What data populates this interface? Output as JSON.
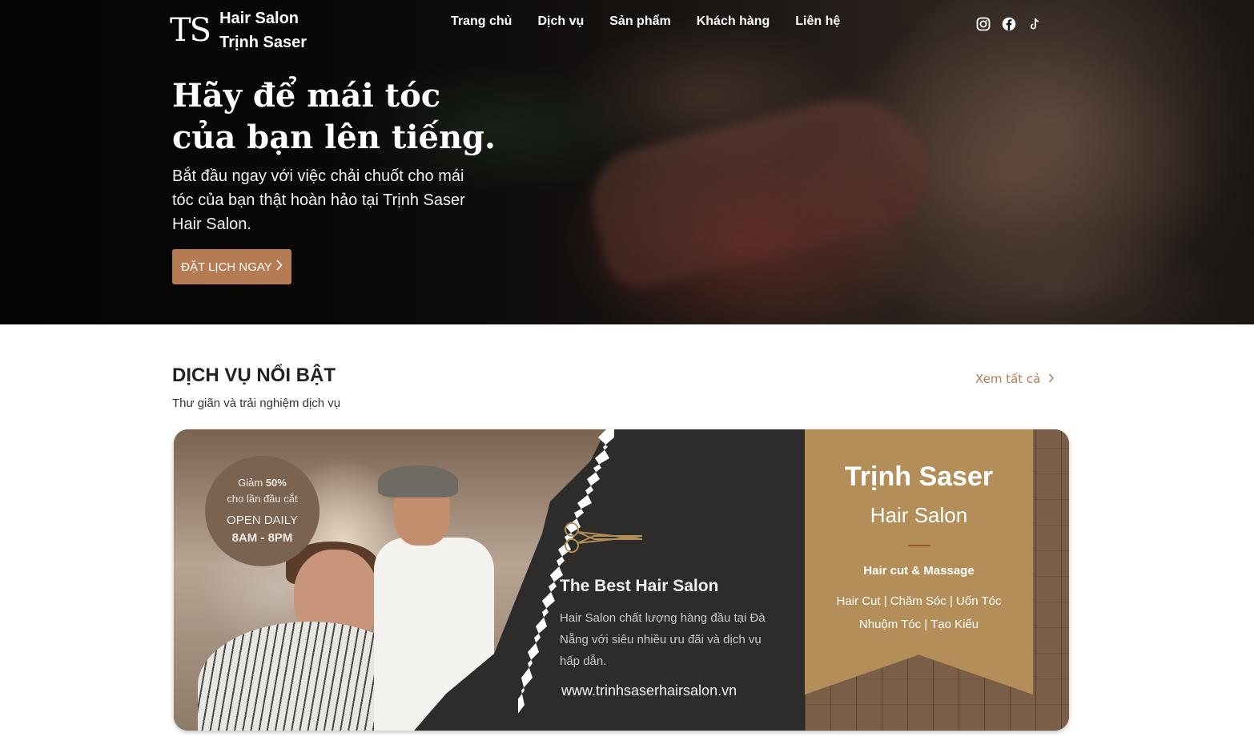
{
  "brand": {
    "mark": "TS",
    "name_line1": "Hair Salon",
    "name_line2": "Trịnh Saser"
  },
  "nav": {
    "items": [
      {
        "label": "Trang chủ"
      },
      {
        "label": "Dịch vụ"
      },
      {
        "label": "Sản phẩm"
      },
      {
        "label": "Khách hàng"
      },
      {
        "label": "Liên hệ"
      }
    ]
  },
  "social": {
    "icons": [
      "instagram-icon",
      "facebook-icon",
      "tiktok-icon"
    ]
  },
  "hero": {
    "title_line1": "Hãy để mái tóc",
    "title_line2": "của bạn lên tiếng.",
    "subtitle": "Bắt đầu ngay với việc chải chuốt cho mái tóc của bạn thật hoàn hảo tại Trịnh Saser Hair Salon.",
    "cta_label": "ĐẶT LỊCH NGAY",
    "cta_color": "#b57b52"
  },
  "featured": {
    "title": "DỊCH VỤ NỔI BẬT",
    "subtitle": "Thư giãn và trải nghiệm dịch vụ",
    "see_all": "Xem tất cả"
  },
  "banner": {
    "badge_l1_prefix": "Giảm",
    "badge_l1_value": "50%",
    "badge_l2": "cho lần đầu cắt",
    "badge_l3": "OPEN DAILY",
    "badge_l4": "8AM - 8PM",
    "headline": "The Best Hair Salon",
    "description": "Hair Salon chất lượng hàng đầu tại Đà Nẵng với siêu nhiều ưu đãi và dịch vụ hấp dẫn.",
    "url": "www.trinhsaserhairsalon.vn",
    "ribbon_title": "Trịnh Saser",
    "ribbon_subtitle": "Hair Salon",
    "ribbon_services_title": "Hair cut & Massage",
    "ribbon_services_line1": "Hair Cut | Chăm Sóc | Uốn Tóc",
    "ribbon_services_line2": "Nhuộm Tóc | Tạo Kiểu",
    "gold_color": "#b48e59"
  }
}
